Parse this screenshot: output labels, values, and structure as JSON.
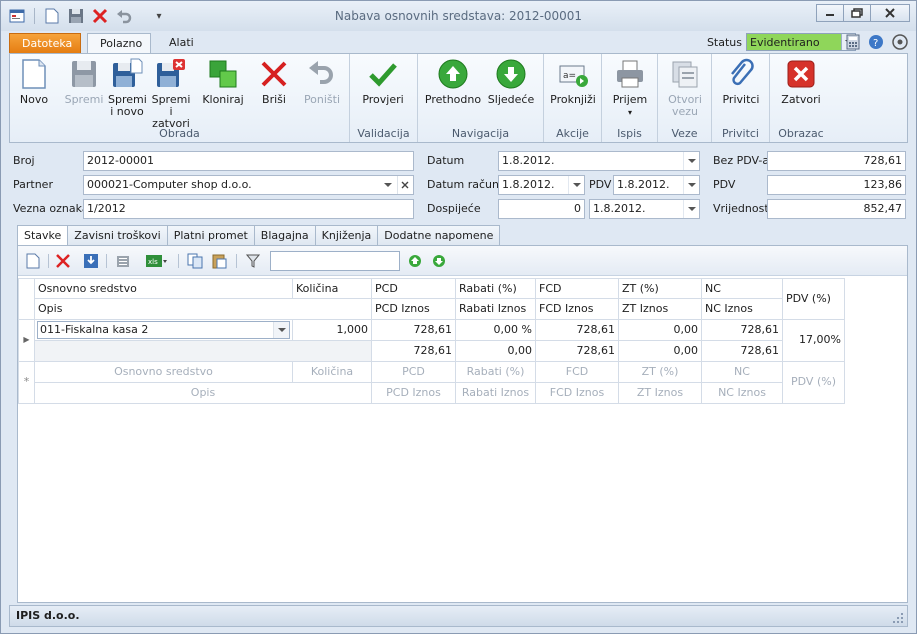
{
  "window": {
    "title": "Nabava osnovnih sredstava: 2012-00001"
  },
  "ribbon_tabs": {
    "file": "Datoteka",
    "home": "Polazno",
    "tools": "Alati"
  },
  "status": {
    "label": "Status",
    "value": "Evidentirano",
    "color": "#8fd65a"
  },
  "ribbon": {
    "groups": {
      "obrada": "Obrada",
      "validacija": "Validacija",
      "navigacija": "Navigacija",
      "akcije": "Akcije",
      "ispis": "Ispis",
      "veze": "Veze",
      "privitci": "Privitci",
      "obrazac": "Obrazac"
    },
    "buttons": {
      "novo": "Novo",
      "spremi": "Spremi",
      "spremi_novo_1": "Spremi",
      "spremi_novo_2": "i novo",
      "spremi_zatvori_1": "Spremi i",
      "spremi_zatvori_2": "zatvori",
      "kloniraj": "Kloniraj",
      "brisi": "Briši",
      "ponisti": "Poništi",
      "provjeri": "Provjeri",
      "prethodno": "Prethodno",
      "sljedece": "Sljedeće",
      "proknjizi": "Proknjiži",
      "prijem": "Prijem",
      "otvori_1": "Otvori",
      "otvori_2": "vezu",
      "privitci": "Privitci",
      "zatvori": "Zatvori"
    }
  },
  "form": {
    "broj_label": "Broj",
    "broj": "2012-00001",
    "partner_label": "Partner",
    "partner": "000021-Computer shop d.o.o.",
    "vezna_label": "Vezna oznaka",
    "vezna": "1/2012",
    "datum_label": "Datum",
    "datum": "1.8.2012.",
    "datum_racuna_label": "Datum računa",
    "datum_racuna": "1.8.2012.",
    "pdv_label": "PDV",
    "pdv_datum": "1.8.2012.",
    "dospijece_label": "Dospijeće",
    "dospijece_dani": "0",
    "dospijece_datum": "1.8.2012.",
    "bez_pdv_label": "Bez PDV-a",
    "bez_pdv": "728,61",
    "pdv_iznos_label": "PDV",
    "pdv_iznos": "123,86",
    "vrijednost_label": "Vrijednost",
    "vrijednost": "852,47"
  },
  "doc_tabs": [
    "Stavke",
    "Zavisni troškovi",
    "Platni promet",
    "Blagajna",
    "Knjiženja",
    "Dodatne napomene"
  ],
  "grid": {
    "headers_top": [
      "Osnovno sredstvo",
      "Količina",
      "PCD",
      "Rabati (%)",
      "FCD",
      "ZT (%)",
      "NC"
    ],
    "headers_bottom": [
      "Opis",
      "PCD Iznos",
      "Rabati Iznos",
      "FCD Iznos",
      "ZT Iznos",
      "NC Iznos"
    ],
    "header_pdv": "PDV (%)",
    "row": {
      "sredstvo": "011-Fiskalna kasa 2",
      "kolicina": "1,000",
      "pcd": "728,61",
      "rabati": "0,00 %",
      "fcd": "728,61",
      "zt": "0,00",
      "nc": "728,61",
      "pcd_iznos": "728,61",
      "rabati_iznos": "0,00",
      "fcd_iznos": "728,61",
      "zt_iznos": "0,00",
      "nc_iznos": "728,61",
      "pdv": "17,00%"
    },
    "new_row_top": [
      "Osnovno sredstvo",
      "Količina",
      "PCD",
      "Rabati (%)",
      "FCD",
      "ZT (%)",
      "NC"
    ],
    "new_row_bottom": [
      "Opis",
      "PCD Iznos",
      "Rabati Iznos",
      "FCD Iznos",
      "ZT Iznos",
      "NC Iznos"
    ],
    "new_row_pdv": "PDV (%)"
  },
  "statusbar": {
    "company": "IPIS d.o.o."
  }
}
